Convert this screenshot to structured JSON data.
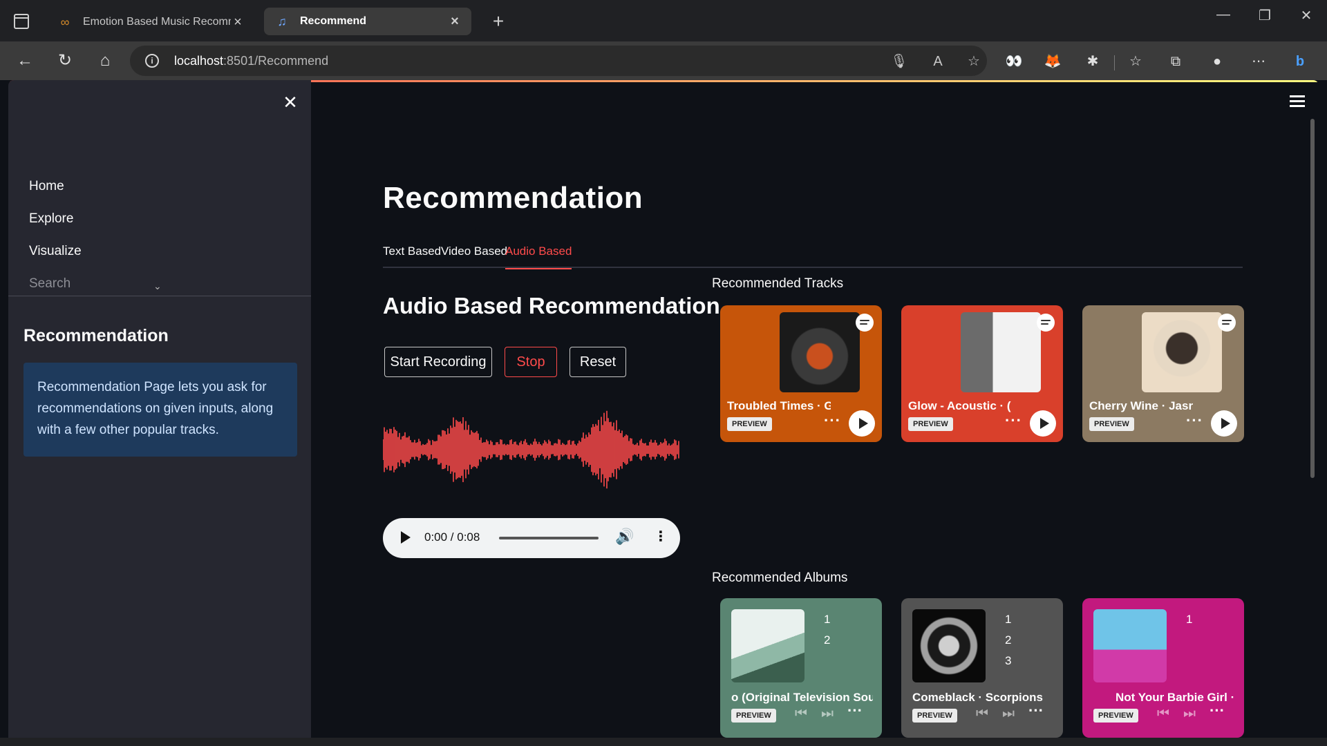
{
  "browser": {
    "tabs": [
      {
        "label": "Emotion Based Music Recommer",
        "active": false
      },
      {
        "label": "Recommend",
        "active": true
      }
    ],
    "url_host": "localhost",
    "url_path": ":8501/Recommend"
  },
  "sidebar": {
    "nav": [
      "Home",
      "Explore",
      "Visualize",
      "Search"
    ],
    "section_title": "Recommendation",
    "info": "Recommendation Page lets you ask for recommendations on given inputs, along with a few other popular tracks."
  },
  "main": {
    "title": "Recommendation",
    "tabs": [
      "Text Based",
      "Video Based",
      "Audio Based"
    ],
    "active_tab": "Audio Based",
    "section_title": "Audio Based Recommendation",
    "buttons": {
      "start": "Start Recording",
      "stop": "Stop",
      "reset": "Reset"
    },
    "audio_player": {
      "time": "0:00 / 0:08"
    },
    "tracks_heading": "Recommended Tracks",
    "albums_heading": "Recommended Albums",
    "preview_label": "PREVIEW",
    "tracks": [
      {
        "title": "Troubled Times · G",
        "color": "#c6550a"
      },
      {
        "title": "Glow - Acoustic · (",
        "color": "#d9402b"
      },
      {
        "title": "Cherry Wine · Jasr",
        "color": "#8c7a62"
      }
    ],
    "albums": [
      {
        "title": "o (Original Television Sou",
        "numbers": [
          "1",
          "2"
        ],
        "color": "#5a8572"
      },
      {
        "title": "Comeblack · Scorpions",
        "numbers": [
          "1",
          "2",
          "3"
        ],
        "color": "#535353"
      },
      {
        "title": "Not Your Barbie Girl ·",
        "numbers": [
          "1"
        ],
        "color": "#c2197e"
      }
    ]
  },
  "colors": {
    "accent": "#ff4b4b",
    "sidebar_bg": "#262730",
    "app_bg": "#0e1117"
  }
}
